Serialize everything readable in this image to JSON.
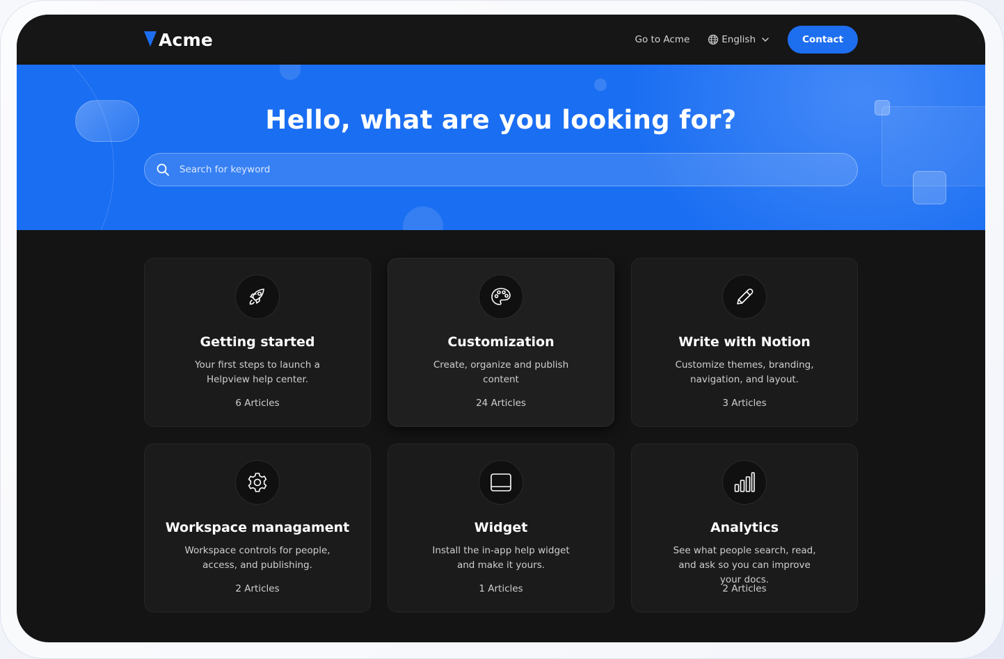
{
  "header": {
    "brand": "Acme",
    "nav_link": "Go to Acme",
    "language": "English",
    "contact_label": "Contact"
  },
  "hero": {
    "title": "Hello, what are you looking for?",
    "search_placeholder": "Search for keyword"
  },
  "categories": [
    {
      "icon": "rocket-icon",
      "title": "Getting started",
      "description": "Your first steps to launch a Helpview help center.",
      "count": "6 Articles"
    },
    {
      "icon": "palette-icon",
      "title": "Customization",
      "description": "Create, organize and publish content",
      "count": "24 Articles"
    },
    {
      "icon": "pencil-icon",
      "title": "Write with Notion",
      "description": "Customize themes, branding, navigation, and layout.",
      "count": "3 Articles"
    },
    {
      "icon": "gear-icon",
      "title": "Workspace managament",
      "description": "Workspace controls for people, access, and publishing.",
      "count": "2 Articles"
    },
    {
      "icon": "widget-icon",
      "title": "Widget",
      "description": "Install the in-app help widget and make it yours.",
      "count": "1 Articles"
    },
    {
      "icon": "bar-chart-icon",
      "title": "Analytics",
      "description": "See what people search, read, and ask so you can improve your docs.",
      "count": "2 Articles"
    }
  ],
  "colors": {
    "accent": "#1e6ef0",
    "hero_background": "#1a6ef2",
    "page_background": "#141414",
    "card_background": "#1b1b1b"
  }
}
